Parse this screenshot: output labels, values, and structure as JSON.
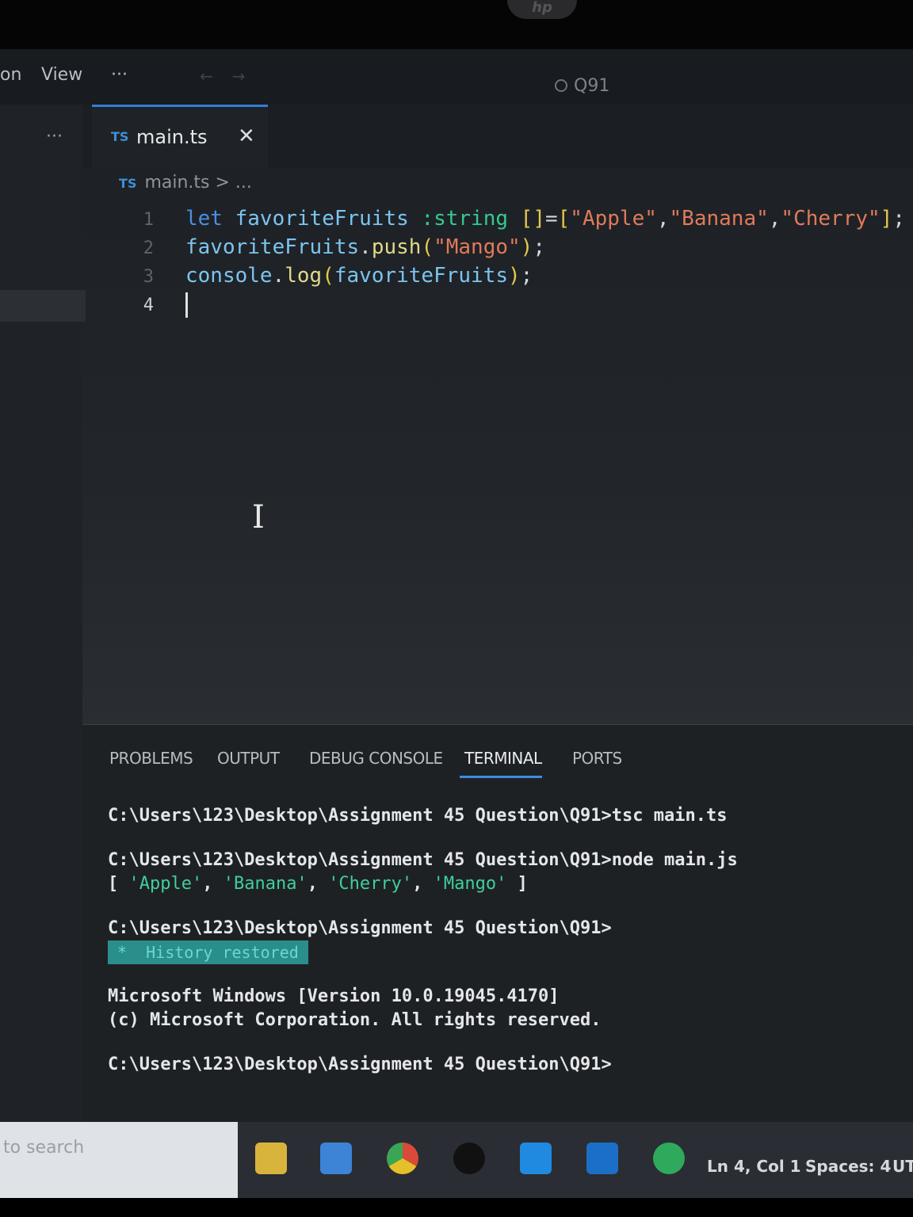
{
  "menu": {
    "item_partial": "on",
    "view": "View",
    "more": "···",
    "back_arrow": "←",
    "forward_arrow": "→"
  },
  "search": {
    "text": "Q91"
  },
  "sidebar": {
    "more": "···"
  },
  "tab": {
    "badge": "TS",
    "label": "main.ts",
    "close": "✕"
  },
  "breadcrumb": {
    "badge": "TS",
    "path": "main.ts > ..."
  },
  "editor": {
    "lines": [
      {
        "num": "1",
        "tokens": [
          {
            "t": "let ",
            "c": "kw"
          },
          {
            "t": "favoriteFruits ",
            "c": "var"
          },
          {
            "t": ":string ",
            "c": "type"
          },
          {
            "t": "[]",
            "c": "br"
          },
          {
            "t": "=",
            "c": "plain"
          },
          {
            "t": "[",
            "c": "br"
          },
          {
            "t": "\"Apple\"",
            "c": "str"
          },
          {
            "t": ",",
            "c": "plain"
          },
          {
            "t": "\"Banana\"",
            "c": "str"
          },
          {
            "t": ",",
            "c": "plain"
          },
          {
            "t": "\"Cherry\"",
            "c": "str"
          },
          {
            "t": "]",
            "c": "br"
          },
          {
            "t": ";",
            "c": "plain"
          }
        ]
      },
      {
        "num": "2",
        "tokens": [
          {
            "t": "favoriteFruits",
            "c": "var"
          },
          {
            "t": ".",
            "c": "plain"
          },
          {
            "t": "push",
            "c": "fn"
          },
          {
            "t": "(",
            "c": "br"
          },
          {
            "t": "\"Mango\"",
            "c": "str"
          },
          {
            "t": ")",
            "c": "br"
          },
          {
            "t": ";",
            "c": "plain"
          }
        ]
      },
      {
        "num": "3",
        "tokens": [
          {
            "t": "console",
            "c": "var"
          },
          {
            "t": ".",
            "c": "plain"
          },
          {
            "t": "log",
            "c": "fn"
          },
          {
            "t": "(",
            "c": "br"
          },
          {
            "t": "favoriteFruits",
            "c": "var"
          },
          {
            "t": ")",
            "c": "br"
          },
          {
            "t": ";",
            "c": "plain"
          }
        ]
      },
      {
        "num": "4",
        "tokens": []
      }
    ]
  },
  "panel": {
    "tabs": [
      "PROBLEMS",
      "OUTPUT",
      "DEBUG CONSOLE",
      "TERMINAL",
      "PORTS"
    ],
    "active_tab": "TERMINAL"
  },
  "terminal": {
    "line1": "C:\\Users\\123\\Desktop\\Assignment 45 Question\\Q91>tsc main.ts",
    "line2": "C:\\Users\\123\\Desktop\\Assignment 45 Question\\Q91>node main.js",
    "output_open": "[ ",
    "output_items": [
      "'Apple'",
      "'Banana'",
      "'Cherry'",
      "'Mango'"
    ],
    "output_close": " ]",
    "line3": "C:\\Users\\123\\Desktop\\Assignment 45 Question\\Q91>",
    "history": "*  History restored",
    "ms1": "Microsoft Windows [Version 10.0.19045.4170]",
    "ms2": "(c) Microsoft Corporation. All rights reserved.",
    "line4": "C:\\Users\\123\\Desktop\\Assignment 45 Question\\Q91>"
  },
  "taskbar": {
    "search_placeholder": "to search",
    "status_position": "Ln 4, Col 1",
    "status_spaces": "Spaces: 4",
    "status_encoding": "UT"
  },
  "colors": {
    "accent": "#3a8ee6",
    "string": "#e07a5a",
    "keyword": "#4a8fe0",
    "type": "#34c98f",
    "terminal_string": "#3fcf9c"
  }
}
